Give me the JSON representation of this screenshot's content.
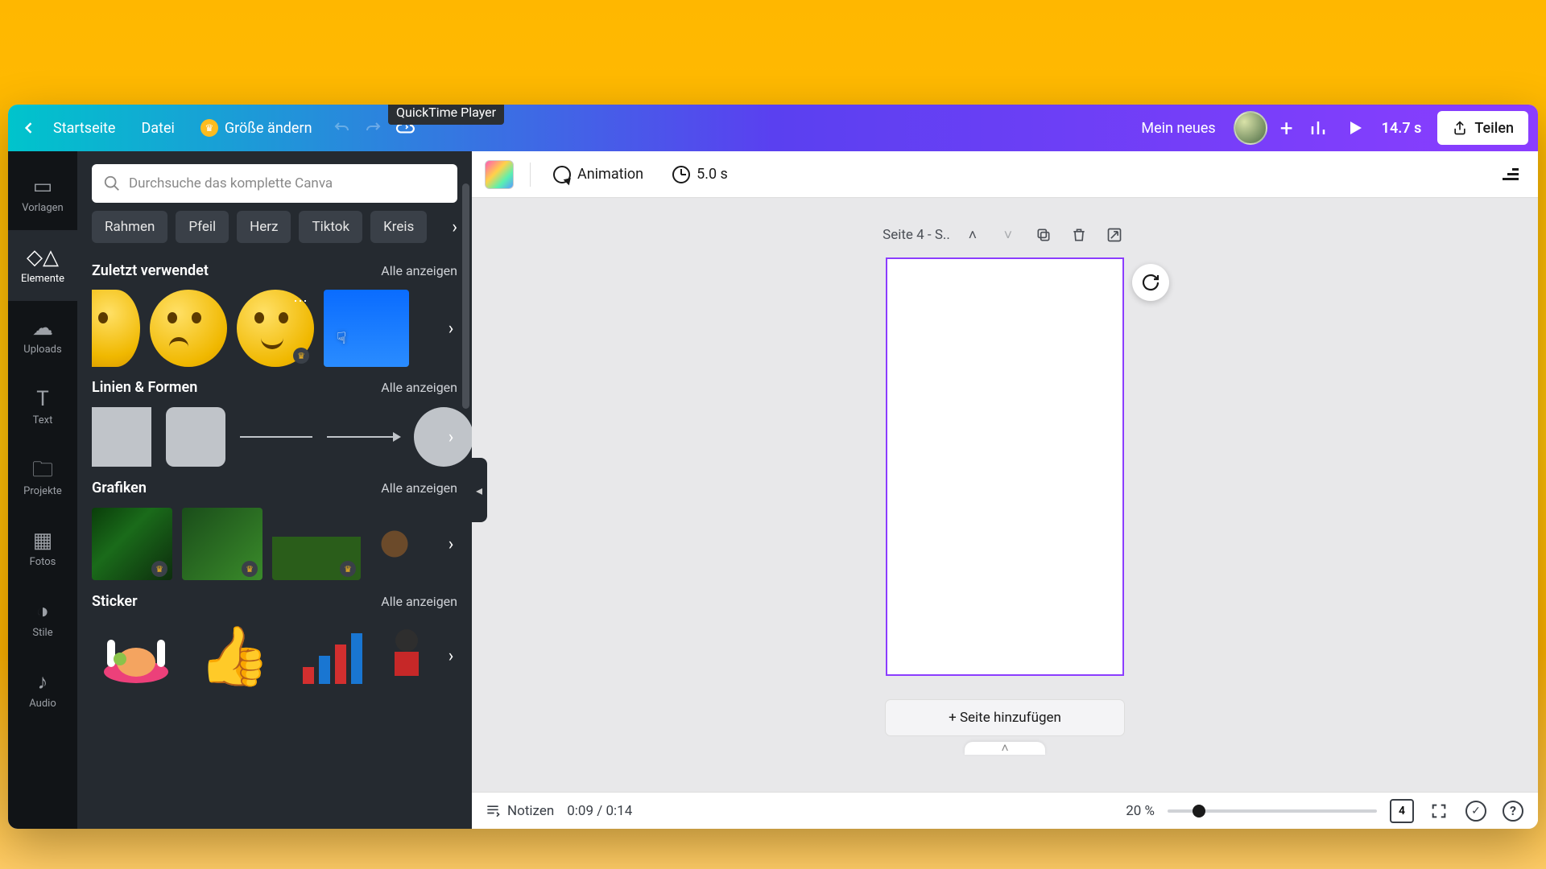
{
  "header": {
    "home": "Startseite",
    "file": "Datei",
    "resize": "Größe ändern",
    "tooltip": "QuickTime Player",
    "project_title": "Mein neues",
    "duration": "14.7 s",
    "share": "Teilen"
  },
  "rail": [
    {
      "id": "vorlagen",
      "label": "Vorlagen",
      "icon": "▭"
    },
    {
      "id": "elemente",
      "label": "Elemente",
      "icon": "△",
      "active": true
    },
    {
      "id": "uploads",
      "label": "Uploads",
      "icon": "☁"
    },
    {
      "id": "text",
      "label": "Text",
      "icon": "T"
    },
    {
      "id": "projekte",
      "label": "Projekte",
      "icon": "🗀"
    },
    {
      "id": "fotos",
      "label": "Fotos",
      "icon": "▦"
    },
    {
      "id": "stile",
      "label": "Stile",
      "icon": "◑"
    },
    {
      "id": "audio",
      "label": "Audio",
      "icon": "♪"
    }
  ],
  "search": {
    "placeholder": "Durchsuche das komplette Canva"
  },
  "chips": [
    "Rahmen",
    "Pfeil",
    "Herz",
    "Tiktok",
    "Kreis"
  ],
  "sections": {
    "recent": {
      "title": "Zuletzt verwendet",
      "all": "Alle anzeigen"
    },
    "shapes": {
      "title": "Linien & Formen",
      "all": "Alle anzeigen"
    },
    "graphics": {
      "title": "Grafiken",
      "all": "Alle anzeigen"
    },
    "sticker": {
      "title": "Sticker",
      "all": "Alle anzeigen"
    }
  },
  "toolbar": {
    "animation": "Animation",
    "timing": "5.0 s"
  },
  "page": {
    "label": "Seite 4 - S..",
    "add": "+ Seite hinzufügen"
  },
  "bottom": {
    "notes": "Notizen",
    "time_current": "0:09",
    "time_total": "0:14",
    "zoom": "20 %",
    "page_count": "4"
  }
}
